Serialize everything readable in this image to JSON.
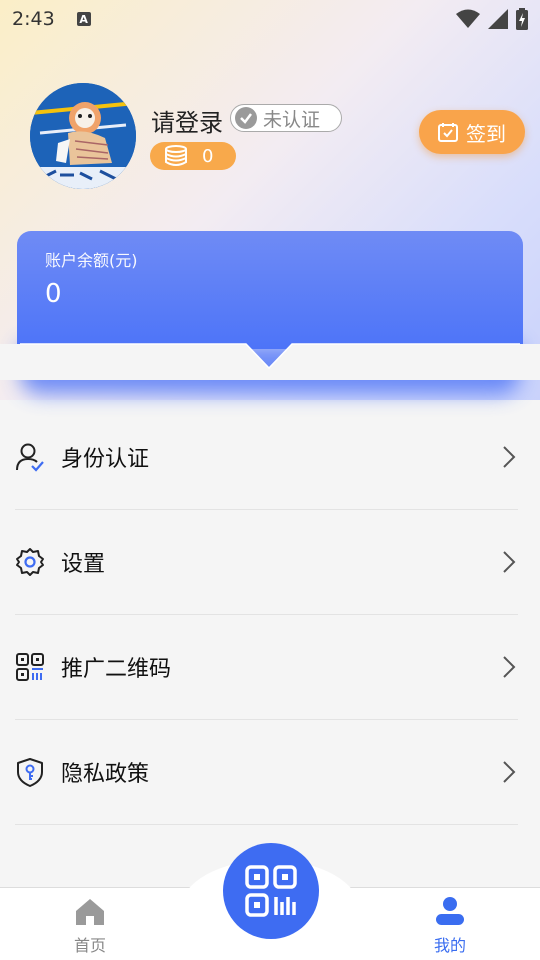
{
  "status_bar": {
    "time": "2:43",
    "notification_glyph": "A"
  },
  "profile": {
    "login_prompt": "请登录",
    "cert_status": "未认证",
    "coins": "0",
    "signin_label": "签到"
  },
  "balance": {
    "label": "账户余额(元)",
    "value": "0"
  },
  "menu": [
    {
      "label": "身份认证",
      "icon": "user-check-icon"
    },
    {
      "label": "设置",
      "icon": "gear-icon"
    },
    {
      "label": "推广二维码",
      "icon": "qr-code-icon"
    },
    {
      "label": "隐私政策",
      "icon": "shield-key-icon"
    }
  ],
  "tabbar": {
    "home_label": "首页",
    "mine_label": "我的"
  },
  "colors": {
    "accent": "#3e6cf2",
    "orange": "#f9a44b",
    "card": "#4d74f8"
  }
}
